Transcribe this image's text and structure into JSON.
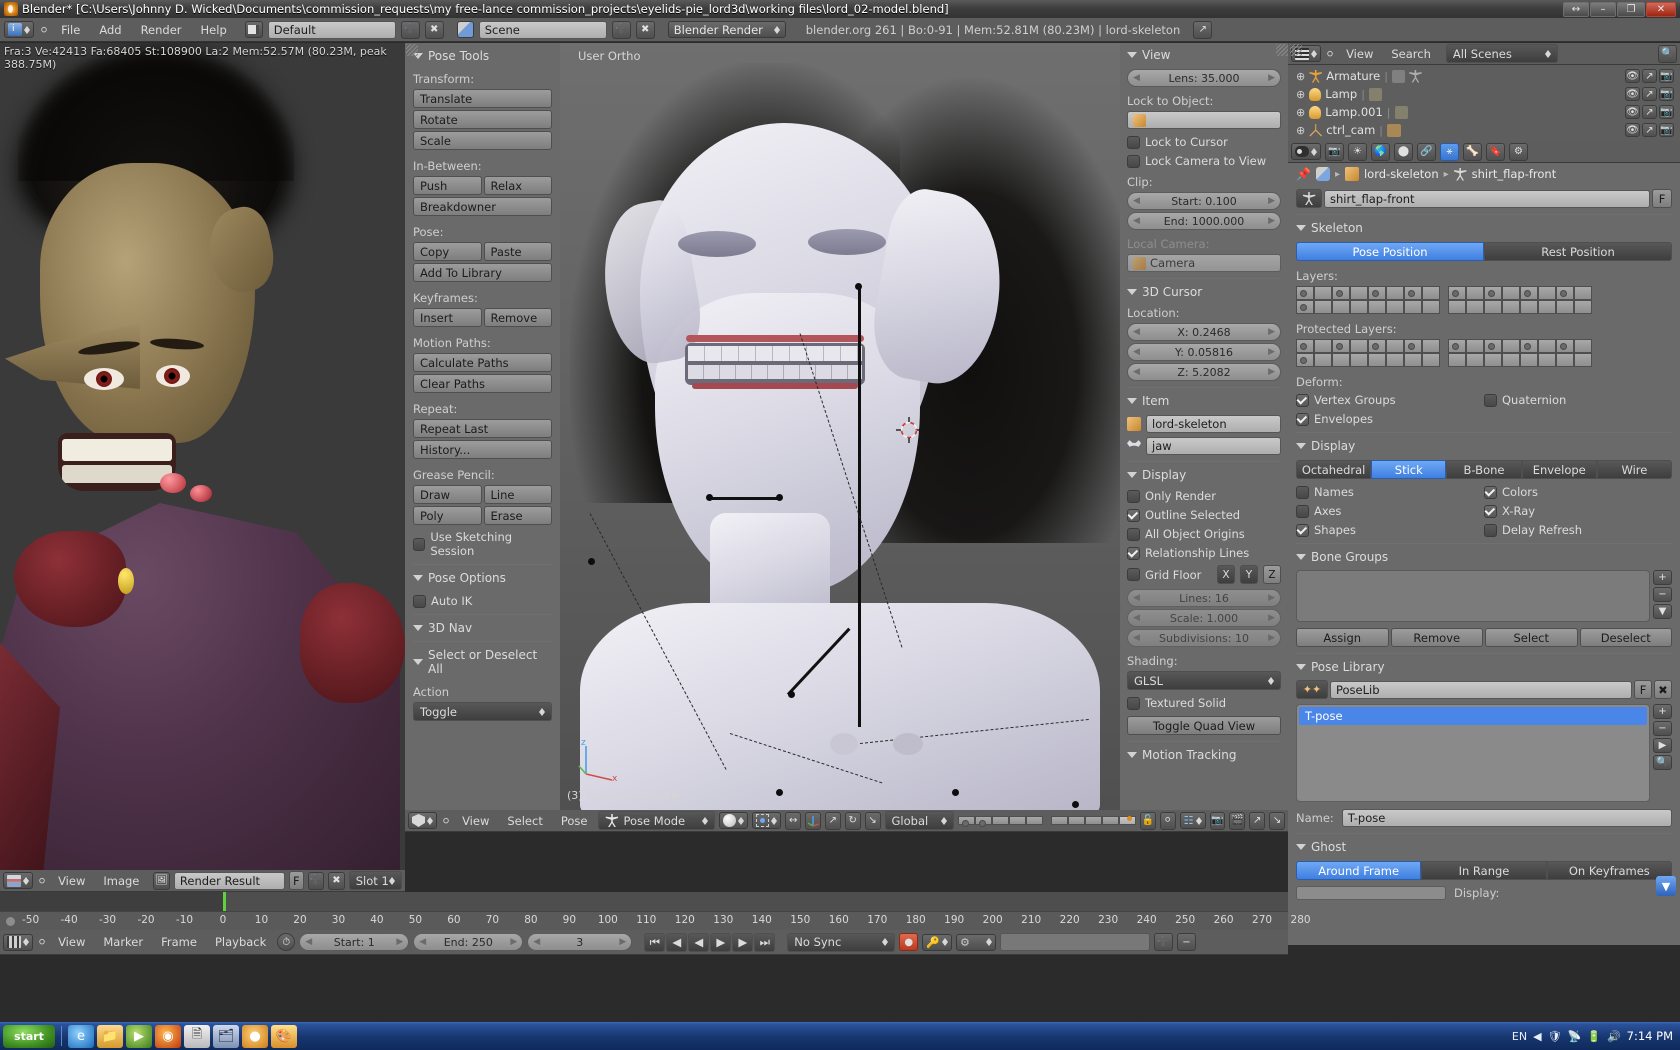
{
  "window": {
    "title": "Blender* [C:\\Users\\Johnny D. Wicked\\Documents\\commission_requests\\my free-lance commission_projects\\eyelids-pie_lord3d\\working files\\lord_02-model.blend]",
    "buttons": {
      "resize": "↔",
      "minimize": "–",
      "restore": "❐",
      "close": "✕"
    }
  },
  "topbar": {
    "menus": [
      "File",
      "Add",
      "Render",
      "Help"
    ],
    "screen_layout": "Default",
    "scene": "Scene",
    "engine": "Blender Render",
    "status": "blender.org 261 | Bo:0-91  | Mem:52.81M (80.23M) | lord-skeleton",
    "add_icon": "plus-icon",
    "x_icon": "x-icon"
  },
  "render_view": {
    "info": "Fra:3  Ve:42413 Fa:68405 St:108900 La:2 Mem:52.57M (80.23M, peak 388.75M)",
    "header": {
      "menus": [
        "View",
        "Image"
      ],
      "image_name": "Render Result",
      "fake_user": "F",
      "slot": "Slot 1"
    }
  },
  "tool_panel": {
    "title": "Pose Tools",
    "groups": [
      {
        "label": "Transform:",
        "rows": [
          [
            "Translate"
          ],
          [
            "Rotate"
          ],
          [
            "Scale"
          ]
        ]
      },
      {
        "label": "In-Between:",
        "rows": [
          [
            "Push",
            "Relax"
          ],
          [
            "Breakdowner"
          ]
        ]
      },
      {
        "label": "Pose:",
        "rows": [
          [
            "Copy",
            "Paste"
          ],
          [
            "Add To Library"
          ]
        ]
      },
      {
        "label": "Keyframes:",
        "rows": [
          [
            "Insert",
            "Remove"
          ]
        ]
      },
      {
        "label": "Motion Paths:",
        "rows": [
          [
            "Calculate Paths"
          ],
          [
            "Clear Paths"
          ]
        ]
      },
      {
        "label": "Repeat:",
        "rows": [
          [
            "Repeat Last"
          ],
          [
            "History..."
          ]
        ]
      },
      {
        "label": "Grease Pencil:",
        "rows": [
          [
            "Draw",
            "Line"
          ],
          [
            "Poly",
            "Erase"
          ]
        ]
      }
    ],
    "use_sketching_session": "Use Sketching Session",
    "pose_options_title": "Pose Options",
    "auto_ik": "Auto IK",
    "nav_title": "3D Nav",
    "select_title": "Select or Deselect All",
    "action_label": "Action",
    "action_value": "Toggle"
  },
  "viewport": {
    "view_label": "User Ortho",
    "object_label": "(3) lord-skeleton:jaw",
    "header": {
      "menus": [
        "View",
        "Select",
        "Pose"
      ],
      "mode": "Pose Mode",
      "transform_orientation": "Global"
    }
  },
  "npanel": {
    "view": {
      "title": "View",
      "lens": "Lens: 35.000",
      "lock_to_object_label": "Lock to Object:",
      "lock_to_object_value": "",
      "lock_to_cursor": "Lock to Cursor",
      "lock_camera_to_view": "Lock Camera to View",
      "clip_label": "Clip:",
      "clip_start": "Start: 0.100",
      "clip_end": "End: 1000.000",
      "local_camera_label": "Local Camera:",
      "local_camera_value": "Camera"
    },
    "cursor": {
      "title": "3D Cursor",
      "location_label": "Location:",
      "x": "X: 0.2468",
      "y": "Y: 0.05816",
      "z": "Z: 5.2082"
    },
    "item": {
      "title": "Item",
      "object": "lord-skeleton",
      "bone": "jaw"
    },
    "display": {
      "title": "Display",
      "only_render": "Only Render",
      "outline_selected": "Outline Selected",
      "all_object_origins": "All Object Origins",
      "relationship_lines": "Relationship Lines",
      "grid_floor": "Grid Floor",
      "axes": [
        "X",
        "Y",
        "Z"
      ],
      "lines": "Lines: 16",
      "scale": "Scale: 1.000",
      "subdivisions": "Subdivisions: 10",
      "shading_label": "Shading:",
      "shading_value": "GLSL",
      "textured_solid": "Textured Solid",
      "toggle_quad_view": "Toggle Quad View"
    },
    "motion_tracking_title": "Motion Tracking"
  },
  "outliner": {
    "menus": [
      "View",
      "Search"
    ],
    "scene_filter": "All Scenes",
    "items": [
      {
        "name": "Armature",
        "icon": "armature-icon"
      },
      {
        "name": "Lamp",
        "icon": "lamp-icon"
      },
      {
        "name": "Lamp.001",
        "icon": "lamp-icon"
      },
      {
        "name": "ctrl_cam",
        "icon": "empty-icon"
      }
    ]
  },
  "properties": {
    "breadcrumb": {
      "object": "lord-skeleton",
      "data": "shirt_flap-front"
    },
    "datablock_name": "shirt_flap-front",
    "datablock_fake_user": "F",
    "skeleton": {
      "title": "Skeleton",
      "pose_position": "Pose Position",
      "rest_position": "Rest Position",
      "layers_label": "Layers:",
      "protected_layers_label": "Protected Layers:",
      "deform_label": "Deform:",
      "vertex_groups": "Vertex Groups",
      "quaternion": "Quaternion",
      "envelopes": "Envelopes"
    },
    "display": {
      "title": "Display",
      "modes": [
        "Octahedral",
        "Stick",
        "B-Bone",
        "Envelope",
        "Wire"
      ],
      "active_mode": "Stick",
      "names": "Names",
      "colors": "Colors",
      "axes": "Axes",
      "xray": "X-Ray",
      "shapes": "Shapes",
      "delay_refresh": "Delay Refresh"
    },
    "bone_groups": {
      "title": "Bone Groups",
      "buttons": [
        "Assign",
        "Remove",
        "Select",
        "Deselect"
      ]
    },
    "pose_library": {
      "title": "Pose Library",
      "datablock": "PoseLib",
      "fake_user": "F",
      "poses": [
        "T-pose"
      ],
      "selected_pose": "T-pose",
      "name_label": "Name:",
      "name_value": "T-pose"
    },
    "ghost": {
      "title": "Ghost",
      "modes": [
        "Around Frame",
        "In Range",
        "On Keyframes"
      ],
      "active_mode": "Around Frame",
      "display_label": "Display:"
    }
  },
  "timeline": {
    "ticks": [
      "-50",
      "-40",
      "-30",
      "-20",
      "-10",
      "0",
      "10",
      "20",
      "30",
      "40",
      "50",
      "60",
      "70",
      "80",
      "90",
      "100",
      "110",
      "120",
      "130",
      "140",
      "150",
      "160",
      "170",
      "180",
      "190",
      "200",
      "210",
      "220",
      "230",
      "240",
      "250",
      "260",
      "270",
      "280"
    ],
    "current_frame": 3,
    "header": {
      "menus": [
        "View",
        "Marker",
        "Frame",
        "Playback"
      ],
      "start_label": "Start: 1",
      "end_label": "End: 250",
      "frame_value": "3",
      "sync_mode": "No Sync"
    }
  },
  "taskbar": {
    "start_label": "start",
    "time": "7:14 PM",
    "lang": "EN",
    "icons": [
      "ie-icon",
      "folder-icon",
      "media-icon",
      "firefox-icon",
      "notepad-icon",
      "explorer-icon",
      "blender-icon",
      "paint-icon"
    ]
  },
  "colors": {
    "accent_blue": "#4a86e8",
    "header_gray": "#5d5d5d",
    "panel_gray": "#6a6a6a",
    "viewport_gray": "#636363",
    "playhead_green": "#5ed13c"
  }
}
